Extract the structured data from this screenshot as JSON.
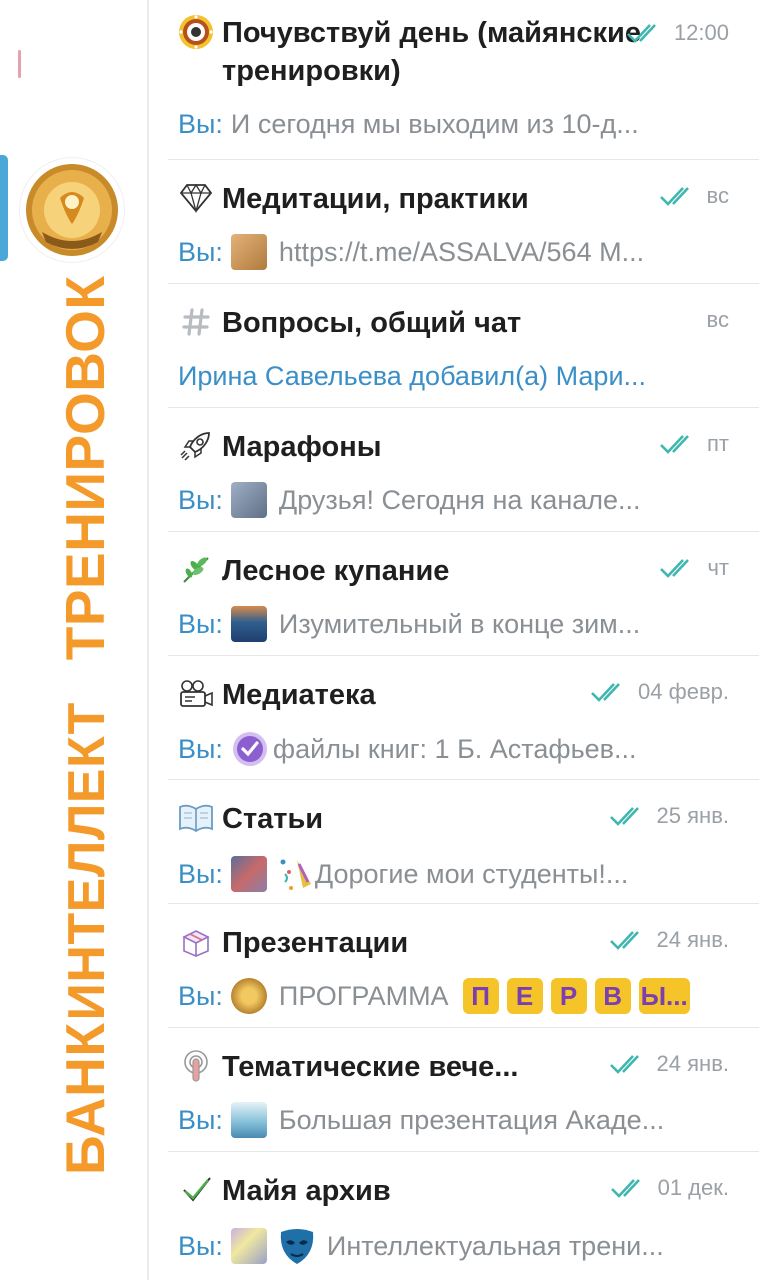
{
  "sidebar": {
    "banner": {
      "part1": "БАНК",
      "part2": "ИНТЕЛЛЕКТ",
      "part3": "ТРЕНИРОВОК"
    },
    "accent_color": "#f39a2a",
    "active_color": "#4aa8d8"
  },
  "chats": [
    {
      "icon": "sun-mandala-icon",
      "title": "Почувствуй день (майянские тренировки)",
      "time": "12:00",
      "read": true,
      "sender": "Вы:",
      "preview": "И сегодня мы выходим из 10-д..."
    },
    {
      "icon": "diamond-icon",
      "title": "Медитации, практики",
      "time": "вс",
      "read": true,
      "sender": "Вы:",
      "thumb_color": "#d79a5a",
      "preview": "https://t.me/ASSALVA/564  M..."
    },
    {
      "icon": "hash-icon",
      "title": "Вопросы, общий чат",
      "time": "вс",
      "read": false,
      "preview": "Ирина Савельева добавил(а) Мари..."
    },
    {
      "icon": "rocket-icon",
      "title": "Марафоны",
      "time": "пт",
      "read": true,
      "sender": "Вы:",
      "thumb_color": "#7a8ea8",
      "preview": "Друзья!  Сегодня на канале..."
    },
    {
      "icon": "herb-icon",
      "title": "Лесное купание",
      "time": "чт",
      "read": true,
      "sender": "Вы:",
      "thumb_color": "#2f5f8f",
      "preview": "Изумительный в конце зим..."
    },
    {
      "icon": "film-projector-icon",
      "title": "Медиатека",
      "time": "04 февр.",
      "read": true,
      "sender": "Вы:",
      "preview": "файлы книг: 1 Б. Астафьев..."
    },
    {
      "icon": "open-book-icon",
      "title": "Статьи",
      "time": "25 янв.",
      "read": true,
      "sender": "Вы:",
      "thumb_color": "#8a7fa8",
      "preview": "Дорогие мои студенты!..."
    },
    {
      "icon": "gift-box-icon",
      "title": "Презентации",
      "time": "24 янв.",
      "read": true,
      "sender": "Вы:",
      "thumb_color": "#d9a040",
      "preview": "ПРОГРАММА",
      "preview_letters": [
        "П",
        "Е",
        "Р",
        "В",
        "Ы..."
      ]
    },
    {
      "icon": "podcast-icon",
      "title": "Тематические вече...",
      "time": "24 янв.",
      "read": true,
      "sender": "Вы:",
      "thumb_color": "#7fbcd6",
      "preview": "Большая презентация Акаде..."
    },
    {
      "icon": "check-mark-icon",
      "title": "Майя архив",
      "time": "01 дек.",
      "read": true,
      "sender": "Вы:",
      "thumb_color": "#9aa0c8",
      "preview": "Интеллектуальная трени..."
    }
  ]
}
